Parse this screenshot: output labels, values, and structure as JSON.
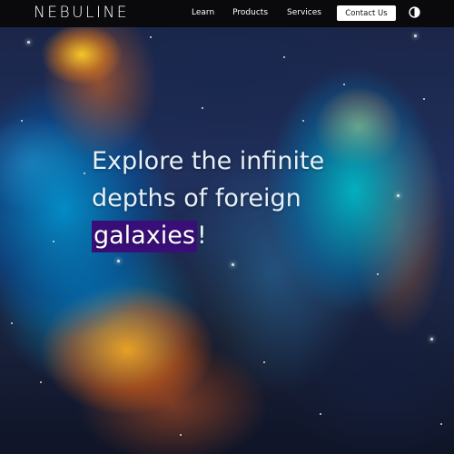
{
  "brand": {
    "logo_text": "NEBULINE"
  },
  "nav": {
    "links": [
      "Learn",
      "Products",
      "Services"
    ],
    "contact_label": "Contact Us",
    "theme_toggle_icon": "contrast-icon"
  },
  "hero": {
    "line1": "Explore the infinite",
    "line2": "depths of foreign",
    "highlight_word": "galaxies",
    "trailing": "!",
    "highlight_color": "#3a0e78"
  },
  "colors": {
    "navbar_bg": "#0a0a0d",
    "button_bg": "#ffffff",
    "text": "#e6f0f8"
  }
}
